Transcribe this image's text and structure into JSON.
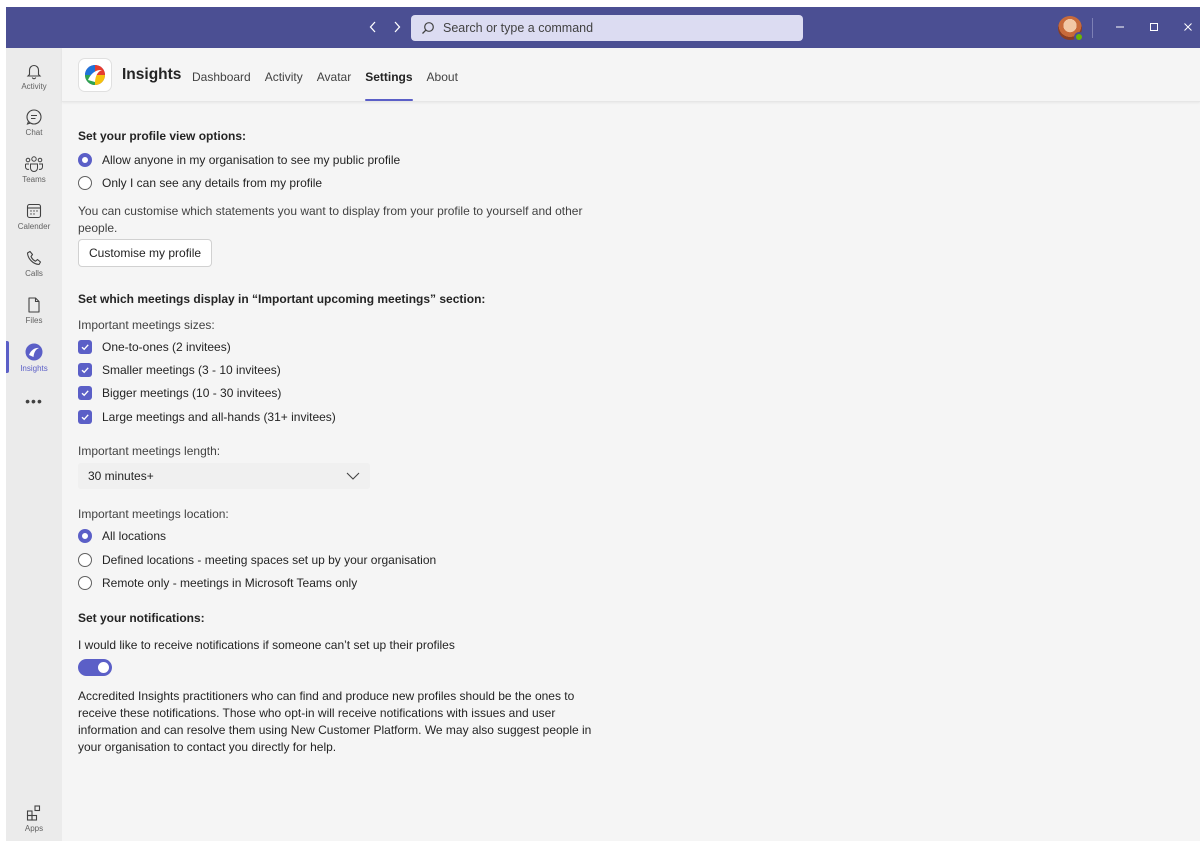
{
  "titlebar": {
    "search_placeholder": "Search or type a command"
  },
  "rail": {
    "items": [
      {
        "label": "Activity",
        "icon": "bell-icon"
      },
      {
        "label": "Chat",
        "icon": "chat-icon"
      },
      {
        "label": "Teams",
        "icon": "teams-icon"
      },
      {
        "label": "Calender",
        "icon": "calendar-icon"
      },
      {
        "label": "Calls",
        "icon": "phone-icon"
      },
      {
        "label": "Files",
        "icon": "file-icon"
      },
      {
        "label": "Insights",
        "icon": "insights-icon"
      }
    ],
    "more": "•••",
    "apps": {
      "label": "Apps",
      "icon": "apps-icon"
    }
  },
  "app": {
    "name": "Insights",
    "tabs": [
      "Dashboard",
      "Activity",
      "Avatar",
      "Settings",
      "About"
    ],
    "active_tab": "Settings"
  },
  "settings": {
    "profile": {
      "heading": "Set your profile view options:",
      "options": [
        {
          "label": "Allow anyone in my organisation to see my public profile",
          "selected": true
        },
        {
          "label": "Only I can see any details from my profile",
          "selected": false
        }
      ],
      "description": "You can customise which statements you want to display from your profile to yourself and other people.",
      "button": "Customise my profile"
    },
    "meetings": {
      "heading": "Set which meetings display in “Important upcoming meetings” section:",
      "sizes_label": "Important meetings sizes:",
      "sizes": [
        {
          "label": "One-to-ones (2 invitees)",
          "checked": true
        },
        {
          "label": "Smaller meetings (3 - 10 invitees)",
          "checked": true
        },
        {
          "label": "Bigger meetings (10 - 30 invitees)",
          "checked": true
        },
        {
          "label": "Large meetings and all-hands (31+ invitees)",
          "checked": true
        }
      ],
      "length_label": "Important meetings length:",
      "length_value": "30 minutes+",
      "location_label": "Important meetings location:",
      "locations": [
        {
          "label": "All locations",
          "selected": true
        },
        {
          "label": "Defined locations - meeting spaces set up by your organisation",
          "selected": false
        },
        {
          "label": "Remote only - meetings in Microsoft Teams only",
          "selected": false
        }
      ]
    },
    "notifications": {
      "heading": "Set your notifications:",
      "label": "I would like to receive notifications if someone can’t set up their profiles",
      "enabled": true,
      "description": "Accredited Insights practitioners who can find and produce new profiles should be the ones to receive these notifications. Those who opt-in will receive notifications with issues and user information and can resolve them using New Customer Platform. We may also suggest people in your organisation to contact you directly for help."
    }
  },
  "colors": {
    "titlebar": "#4b4f93",
    "accent": "#5b5fc7",
    "background": "#f5f5f5",
    "rail": "#ebebeb"
  }
}
